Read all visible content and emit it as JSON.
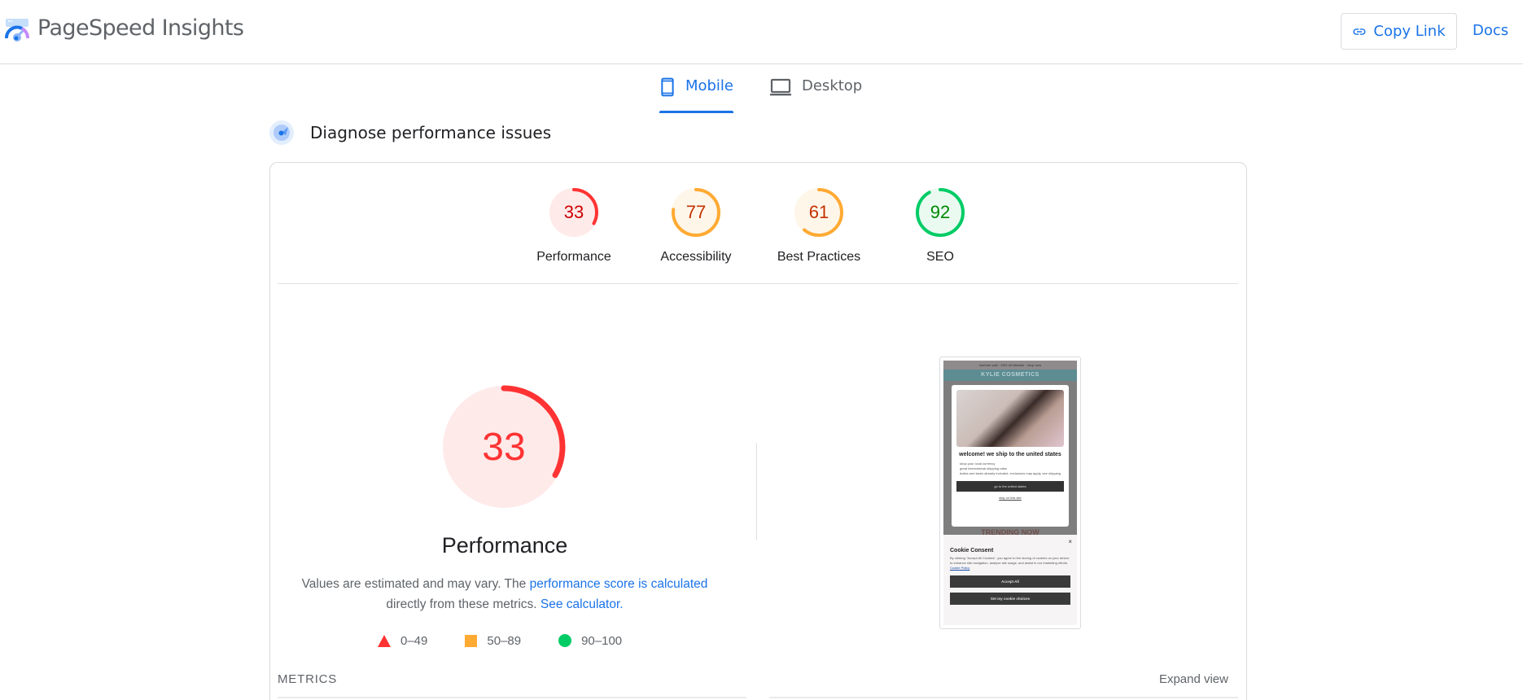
{
  "header": {
    "app_title": "PageSpeed Insights",
    "logo_icon": "pagespeed-gauge-logo",
    "copy_link_label": "Copy Link",
    "copy_link_icon": "link-icon",
    "docs_label": "Docs"
  },
  "tabs": [
    {
      "label": "Mobile",
      "icon": "smartphone-icon",
      "active": true
    },
    {
      "label": "Desktop",
      "icon": "laptop-icon",
      "active": false
    }
  ],
  "section": {
    "title": "Diagnose performance issues",
    "icon": "diagnose-gauge-icon"
  },
  "colors": {
    "accent": "#1a73e8",
    "fail": "#ff3333",
    "fail_bg": "#ffeaea",
    "fail_text": "#cc0000",
    "average": "#ffaa33",
    "average_bg": "#fff6ea",
    "average_text": "#c33300",
    "pass": "#00cc66",
    "pass_bg": "#eafaf1",
    "pass_text": "#008800"
  },
  "scores": [
    {
      "label": "Performance",
      "value": 33,
      "rating": "fail"
    },
    {
      "label": "Accessibility",
      "value": 77,
      "rating": "average"
    },
    {
      "label": "Best Practices",
      "value": 61,
      "rating": "average"
    },
    {
      "label": "SEO",
      "value": 92,
      "rating": "pass"
    }
  ],
  "performance": {
    "score": 33,
    "title": "Performance",
    "desc_prefix": "Values are estimated and may vary. The ",
    "desc_link1": "performance score is calculated",
    "desc_middle": " directly from these metrics. ",
    "desc_link2": "See calculator.",
    "legend": [
      {
        "shape": "triangle",
        "range": "0–49"
      },
      {
        "shape": "square",
        "range": "50–89"
      },
      {
        "shape": "circle",
        "range": "90–100"
      }
    ]
  },
  "screenshot": {
    "promo_text": "summer sale · 25% off sitewide · shop now",
    "brand": "KYLIE COSMETICS",
    "modal_title": "welcome! we ship to the united states",
    "modal_list": [
      "shop your local currency",
      "great international shipping rates",
      "duties and taxes already included, exclusions may apply, see shipping"
    ],
    "modal_button": "go to the united states",
    "modal_link": "stay on this site",
    "trending": "TRENDING NOW",
    "cookie_close": "×",
    "cookie_title": "Cookie Consent",
    "cookie_text": "By clicking \"Accept All Cookies\", you agree to the storing of cookies on your device to enhance site navigation, analyze site usage, and assist in our marketing efforts. ",
    "cookie_policy": "Cookie Policy",
    "cookie_accept": "Accept All",
    "cookie_choices": "Set my cookie choices"
  },
  "metrics": {
    "label": "METRICS",
    "expand_label": "Expand view"
  }
}
